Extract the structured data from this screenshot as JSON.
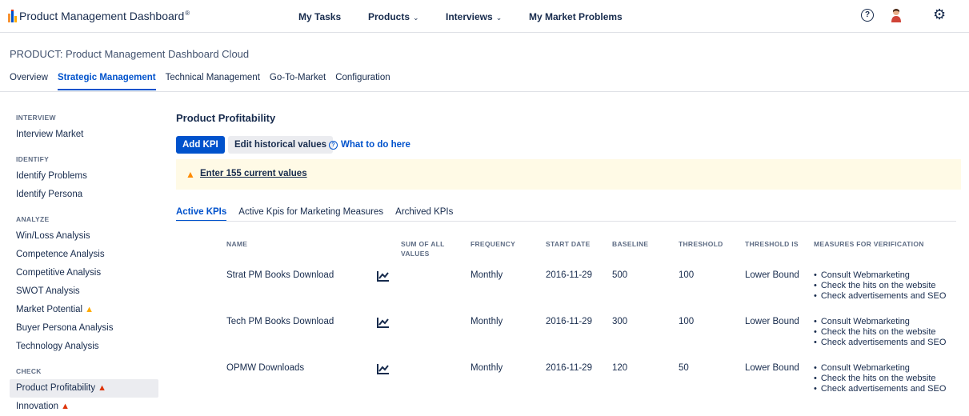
{
  "app": {
    "title": "Product Management Dashboard",
    "trademark": "®"
  },
  "nav": {
    "my_tasks": "My Tasks",
    "products": "Products",
    "interviews": "Interviews",
    "my_market_problems": "My Market Problems",
    "help_glyph": "?"
  },
  "product": {
    "title": "PRODUCT: Product Management Dashboard Cloud"
  },
  "tabs": [
    "Overview",
    "Strategic Management",
    "Technical Management",
    "Go-To-Market",
    "Configuration"
  ],
  "sidebar": {
    "sections": [
      {
        "title": "INTERVIEW",
        "items": [
          {
            "label": "Interview Market"
          }
        ]
      },
      {
        "title": "IDENTIFY",
        "items": [
          {
            "label": "Identify Problems"
          },
          {
            "label": "Identify Persona"
          }
        ]
      },
      {
        "title": "ANALYZE",
        "items": [
          {
            "label": "Win/Loss Analysis"
          },
          {
            "label": "Competence Analysis"
          },
          {
            "label": "Competitive Analysis"
          },
          {
            "label": "SWOT Analysis"
          },
          {
            "label": "Market Potential"
          },
          {
            "label": "Buyer Persona Analysis"
          },
          {
            "label": "Technology Analysis"
          }
        ]
      },
      {
        "title": "CHECK",
        "items": [
          {
            "label": "Product Profitability"
          },
          {
            "label": "Innovation"
          }
        ]
      }
    ]
  },
  "main": {
    "title": "Product Profitability",
    "add_kpi": "Add KPI",
    "edit_historical": "Edit historical values",
    "what_to_do": "What to do here",
    "alert_link": "Enter 155 current values",
    "subtabs": [
      "Active KPIs",
      "Active Kpis for Marketing Measures",
      "Archived KPIs"
    ]
  },
  "table": {
    "headers": {
      "name": "NAME",
      "sum_line1": "SUM OF ALL",
      "sum_line2": "VALUES",
      "frequency": "FREQUENCY",
      "start_date": "START DATE",
      "baseline": "BASELINE",
      "threshold": "THRESHOLD",
      "threshold_is": "THRESHOLD IS",
      "measures": "MEASURES FOR VERIFICATION"
    },
    "rows": [
      {
        "name": "Strat PM Books Download",
        "frequency": "Monthly",
        "start_date": "2016-11-29",
        "baseline": "500",
        "threshold": "100",
        "threshold_is": "Lower Bound",
        "measures": [
          "Consult Webmarketing",
          "Check the hits on the website",
          "Check advertisements and SEO"
        ]
      },
      {
        "name": "Tech PM Books Download",
        "frequency": "Monthly",
        "start_date": "2016-11-29",
        "baseline": "300",
        "threshold": "100",
        "threshold_is": "Lower Bound",
        "measures": [
          "Consult Webmarketing",
          "Check the hits on the website",
          "Check advertisements and SEO"
        ]
      },
      {
        "name": "OPMW Downloads",
        "frequency": "Monthly",
        "start_date": "2016-11-29",
        "baseline": "120",
        "threshold": "50",
        "threshold_is": "Lower Bound",
        "measures": [
          "Consult Webmarketing",
          "Check the hits on the website",
          "Check advertisements and SEO"
        ]
      }
    ]
  },
  "colors": {
    "primary": "#0052cc",
    "text": "#172b4d",
    "warning": "#ffab00",
    "danger": "#de350b",
    "alert_bg": "#fffae6"
  }
}
